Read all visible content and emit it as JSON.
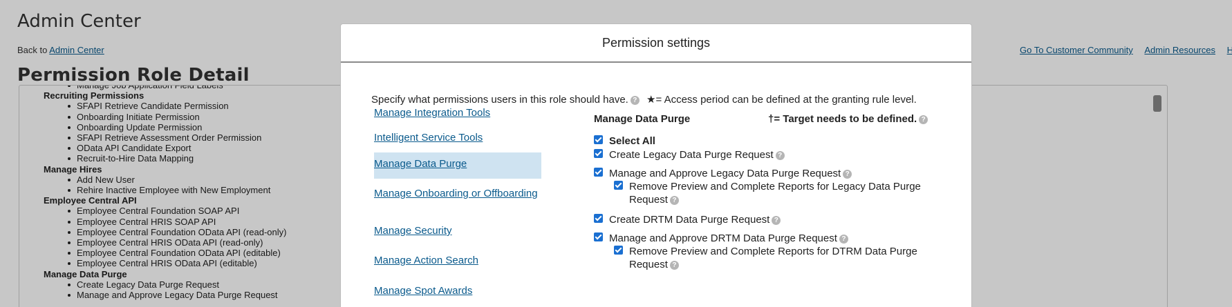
{
  "page": {
    "title": "Admin Center",
    "back_prefix": "Back to",
    "back_link": "Admin Center",
    "heading": "Permission Role Detail",
    "header_links": [
      "Go To Customer Community",
      "Admin Resources",
      "H"
    ]
  },
  "background_list": {
    "partial_top": "Manage Job Application Field Labels",
    "groups": [
      {
        "name": "Recruiting Permissions",
        "items": [
          "SFAPI Retrieve Candidate Permission",
          "Onboarding Initiate Permission",
          "Onboarding Update Permission",
          "SFAPI Retrieve Assessment Order Permission",
          "OData API Candidate Export",
          "Recruit-to-Hire Data Mapping"
        ]
      },
      {
        "name": "Manage Hires",
        "items": [
          "Add New User",
          "Rehire Inactive Employee with New Employment"
        ]
      },
      {
        "name": "Employee Central API",
        "items": [
          "Employee Central Foundation SOAP API",
          "Employee Central HRIS SOAP API",
          "Employee Central Foundation OData API (read-only)",
          "Employee Central HRIS OData API (read-only)",
          "Employee Central Foundation OData API (editable)",
          "Employee Central HRIS OData API (editable)"
        ]
      },
      {
        "name": "Manage Data Purge",
        "items": [
          "Create Legacy Data Purge Request",
          "Manage and Approve Legacy Data Purge Request"
        ]
      }
    ]
  },
  "dialog": {
    "title": "Permission settings",
    "intro": "Specify what permissions users in this role should have.",
    "star_note": "★= Access period can be defined at the granting rule level.",
    "dagger_note": "†= Target needs to be defined.",
    "nav_items": [
      "Manage Integration Tools",
      "Intelligent Service Tools",
      "Manage Data Purge",
      "Manage Onboarding or Offboarding",
      "Manage Security",
      "Manage Action Search",
      "Manage Spot Awards"
    ],
    "selected_nav": "Manage Data Purge",
    "section_title": "Manage Data Purge",
    "select_all": "Select All",
    "permissions": [
      {
        "label": "Create Legacy Data Purge Request",
        "checked": true,
        "help": true,
        "level": 0
      },
      {
        "label": "Manage and Approve Legacy Data Purge Request",
        "checked": true,
        "help": true,
        "level": 0
      },
      {
        "label": "Remove Preview and Complete Reports for Legacy Data Purge Request",
        "checked": true,
        "help": true,
        "level": 1
      },
      {
        "label": "Create DRTM Data Purge Request",
        "checked": true,
        "help": true,
        "level": 0
      },
      {
        "label": "Manage and Approve DRTM Data Purge Request",
        "checked": true,
        "help": true,
        "level": 0
      },
      {
        "label": "Remove Preview and Complete Reports for DTRM Data Purge Request",
        "checked": true,
        "help": true,
        "level": 1
      }
    ]
  }
}
